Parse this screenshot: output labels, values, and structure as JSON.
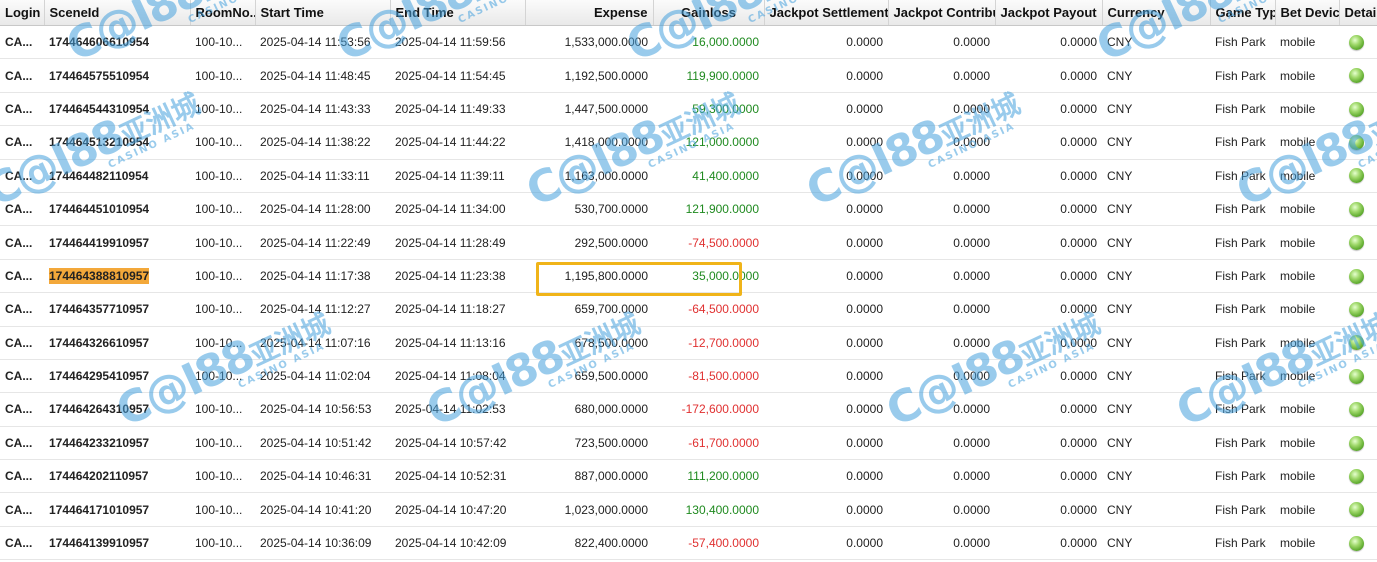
{
  "columns": [
    "Login",
    "SceneId",
    "RoomNo...",
    "Start Time",
    "End Time",
    "Expense",
    "Gainloss",
    "Jackpot Settlement",
    "Jackpot Contribu",
    "Jackpot Payout",
    "Currency",
    "Game Typ",
    "Bet Devic",
    "Details"
  ],
  "colors": {
    "positive": "#1f8a1f",
    "negative": "#e03030",
    "highlight": "#f3a83a",
    "focus": "#f0b419"
  },
  "watermark": {
    "logo": "C@I88",
    "cn": "亚洲城",
    "sub": "CASINO ASIA"
  },
  "rows": [
    {
      "login": "CA...",
      "scene": "174464606610954",
      "room": "100-10...",
      "start": "2025-04-14 11:53:56",
      "end": "2025-04-14 11:59:56",
      "expense": "1,533,000.0000",
      "gain": "16,000.0000",
      "gain_sign": "pos",
      "js": "0.0000",
      "jc": "0.0000",
      "jp": "0.0000",
      "currency": "CNY",
      "game": "Fish Park",
      "device": "mobile",
      "details": "details-icon"
    },
    {
      "login": "CA...",
      "scene": "174464575510954",
      "room": "100-10...",
      "start": "2025-04-14 11:48:45",
      "end": "2025-04-14 11:54:45",
      "expense": "1,192,500.0000",
      "gain": "119,900.0000",
      "gain_sign": "pos",
      "js": "0.0000",
      "jc": "0.0000",
      "jp": "0.0000",
      "currency": "CNY",
      "game": "Fish Park",
      "device": "mobile",
      "details": "details-icon"
    },
    {
      "login": "CA...",
      "scene": "174464544310954",
      "room": "100-10...",
      "start": "2025-04-14 11:43:33",
      "end": "2025-04-14 11:49:33",
      "expense": "1,447,500.0000",
      "gain": "59,300.0000",
      "gain_sign": "pos",
      "js": "0.0000",
      "jc": "0.0000",
      "jp": "0.0000",
      "currency": "CNY",
      "game": "Fish Park",
      "device": "mobile",
      "details": "details-icon"
    },
    {
      "login": "CA...",
      "scene": "174464513210954",
      "room": "100-10...",
      "start": "2025-04-14 11:38:22",
      "end": "2025-04-14 11:44:22",
      "expense": "1,418,000.0000",
      "gain": "121,000.0000",
      "gain_sign": "pos",
      "js": "0.0000",
      "jc": "0.0000",
      "jp": "0.0000",
      "currency": "CNY",
      "game": "Fish Park",
      "device": "mobile",
      "details": "details-icon"
    },
    {
      "login": "CA...",
      "scene": "174464482110954",
      "room": "100-10...",
      "start": "2025-04-14 11:33:11",
      "end": "2025-04-14 11:39:11",
      "expense": "1,163,000.0000",
      "gain": "41,400.0000",
      "gain_sign": "pos",
      "js": "0.0000",
      "jc": "0.0000",
      "jp": "0.0000",
      "currency": "CNY",
      "game": "Fish Park",
      "device": "mobile",
      "details": "details-icon"
    },
    {
      "login": "CA...",
      "scene": "174464451010954",
      "room": "100-10...",
      "start": "2025-04-14 11:28:00",
      "end": "2025-04-14 11:34:00",
      "expense": "530,700.0000",
      "gain": "121,900.0000",
      "gain_sign": "pos",
      "js": "0.0000",
      "jc": "0.0000",
      "jp": "0.0000",
      "currency": "CNY",
      "game": "Fish Park",
      "device": "mobile",
      "details": "details-icon"
    },
    {
      "login": "CA...",
      "scene": "174464419910957",
      "room": "100-10...",
      "start": "2025-04-14 11:22:49",
      "end": "2025-04-14 11:28:49",
      "expense": "292,500.0000",
      "gain": "-74,500.0000",
      "gain_sign": "neg",
      "js": "0.0000",
      "jc": "0.0000",
      "jp": "0.0000",
      "currency": "CNY",
      "game": "Fish Park",
      "device": "mobile",
      "details": "details-icon"
    },
    {
      "login": "CA...",
      "scene": "174464388810957",
      "room": "100-10...",
      "start": "2025-04-14 11:17:38",
      "end": "2025-04-14 11:23:38",
      "expense": "1,195,800.0000",
      "gain": "35,000.0000",
      "gain_sign": "pos",
      "js": "0.0000",
      "jc": "0.0000",
      "jp": "0.0000",
      "currency": "CNY",
      "game": "Fish Park",
      "device": "mobile",
      "details": "details-icon",
      "highlight": true
    },
    {
      "login": "CA...",
      "scene": "174464357710957",
      "room": "100-10...",
      "start": "2025-04-14 11:12:27",
      "end": "2025-04-14 11:18:27",
      "expense": "659,700.0000",
      "gain": "-64,500.0000",
      "gain_sign": "neg",
      "js": "0.0000",
      "jc": "0.0000",
      "jp": "0.0000",
      "currency": "CNY",
      "game": "Fish Park",
      "device": "mobile",
      "details": "details-icon"
    },
    {
      "login": "CA...",
      "scene": "174464326610957",
      "room": "100-10...",
      "start": "2025-04-14 11:07:16",
      "end": "2025-04-14 11:13:16",
      "expense": "678,500.0000",
      "gain": "-12,700.0000",
      "gain_sign": "neg",
      "js": "0.0000",
      "jc": "0.0000",
      "jp": "0.0000",
      "currency": "CNY",
      "game": "Fish Park",
      "device": "mobile",
      "details": "details-icon"
    },
    {
      "login": "CA...",
      "scene": "174464295410957",
      "room": "100-10...",
      "start": "2025-04-14 11:02:04",
      "end": "2025-04-14 11:08:04",
      "expense": "659,500.0000",
      "gain": "-81,500.0000",
      "gain_sign": "neg",
      "js": "0.0000",
      "jc": "0.0000",
      "jp": "0.0000",
      "currency": "CNY",
      "game": "Fish Park",
      "device": "mobile",
      "details": "details-icon"
    },
    {
      "login": "CA...",
      "scene": "174464264310957",
      "room": "100-10...",
      "start": "2025-04-14 10:56:53",
      "end": "2025-04-14 11:02:53",
      "expense": "680,000.0000",
      "gain": "-172,600.0000",
      "gain_sign": "neg",
      "js": "0.0000",
      "jc": "0.0000",
      "jp": "0.0000",
      "currency": "CNY",
      "game": "Fish Park",
      "device": "mobile",
      "details": "details-icon"
    },
    {
      "login": "CA...",
      "scene": "174464233210957",
      "room": "100-10...",
      "start": "2025-04-14 10:51:42",
      "end": "2025-04-14 10:57:42",
      "expense": "723,500.0000",
      "gain": "-61,700.0000",
      "gain_sign": "neg",
      "js": "0.0000",
      "jc": "0.0000",
      "jp": "0.0000",
      "currency": "CNY",
      "game": "Fish Park",
      "device": "mobile",
      "details": "details-icon"
    },
    {
      "login": "CA...",
      "scene": "174464202110957",
      "room": "100-10...",
      "start": "2025-04-14 10:46:31",
      "end": "2025-04-14 10:52:31",
      "expense": "887,000.0000",
      "gain": "111,200.0000",
      "gain_sign": "pos",
      "js": "0.0000",
      "jc": "0.0000",
      "jp": "0.0000",
      "currency": "CNY",
      "game": "Fish Park",
      "device": "mobile",
      "details": "details-icon"
    },
    {
      "login": "CA...",
      "scene": "174464171010957",
      "room": "100-10...",
      "start": "2025-04-14 10:41:20",
      "end": "2025-04-14 10:47:20",
      "expense": "1,023,000.0000",
      "gain": "130,400.0000",
      "gain_sign": "pos",
      "js": "0.0000",
      "jc": "0.0000",
      "jp": "0.0000",
      "currency": "CNY",
      "game": "Fish Park",
      "device": "mobile",
      "details": "details-icon"
    },
    {
      "login": "CA...",
      "scene": "174464139910957",
      "room": "100-10...",
      "start": "2025-04-14 10:36:09",
      "end": "2025-04-14 10:42:09",
      "expense": "822,400.0000",
      "gain": "-57,400.0000",
      "gain_sign": "neg",
      "js": "0.0000",
      "jc": "0.0000",
      "jp": "0.0000",
      "currency": "CNY",
      "game": "Fish Park",
      "device": "mobile",
      "details": "details-icon"
    }
  ]
}
